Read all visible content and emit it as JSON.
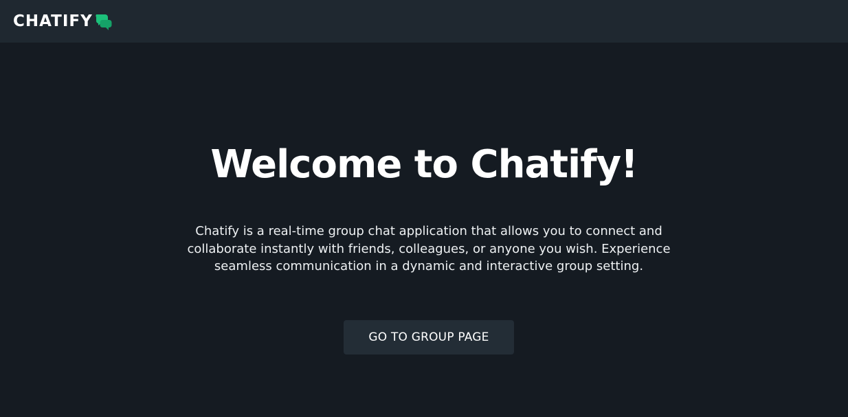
{
  "navbar": {
    "brand_name": "CHATIFY",
    "brand_icon": "chat-bubbles-icon",
    "brand_color": "#1cc07a"
  },
  "hero": {
    "title": "Welcome to Chatify!",
    "description": "Chatify is a real-time group chat application that allows you to connect and collaborate instantly with friends, colleagues, or anyone you wish. Experience seamless communication in a dynamic and interactive group setting.",
    "button_label": "GO TO GROUP PAGE"
  },
  "colors": {
    "background": "#151b22",
    "navbar_background": "#1f2830",
    "button_background": "#232d36",
    "text": "#ffffff"
  }
}
